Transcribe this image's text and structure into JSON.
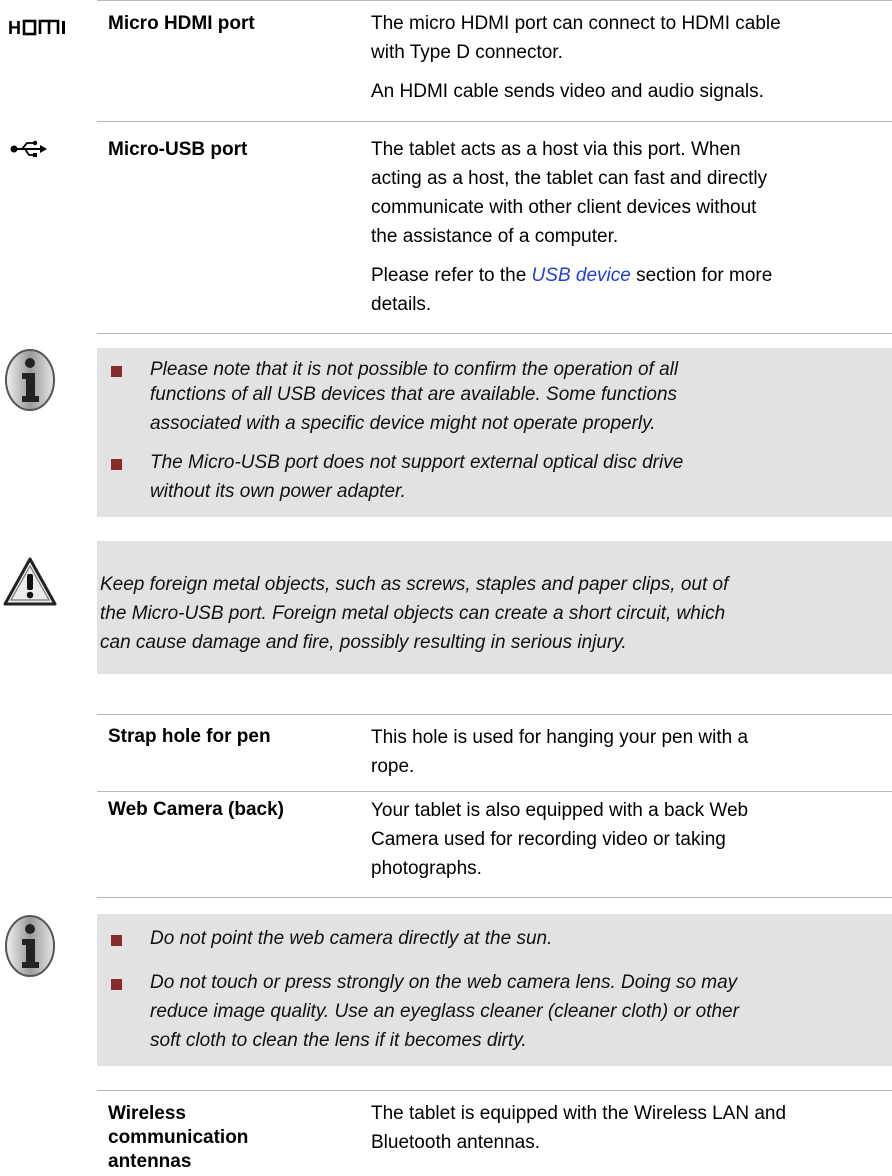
{
  "sections": {
    "hdmi": {
      "icon": "hdmi-logo-icon",
      "icon_text": "HDMI",
      "term": "Micro HDMI port",
      "desc_p1_line1": "The micro HDMI port can connect to HDMI cable",
      "desc_p1_line2": "with Type D connector.",
      "desc_p2": "An HDMI cable sends video and audio signals."
    },
    "usb": {
      "icon": "usb-icon",
      "term": "Micro-USB port",
      "desc_line1": "The tablet acts as a host via this port. When",
      "desc_line2": "acting as a host, the tablet can fast and directly",
      "desc_line3": "communicate with other client devices without",
      "desc_line4": "the assistance of a computer.",
      "ref_before": "Please refer to the ",
      "ref_link": "USB device",
      "ref_after": " section for more",
      "ref_line2": "details."
    },
    "note1": {
      "icon": "info-icon",
      "b1_l1": "Please note that it is not possible to confirm the operation of all",
      "b1_l2": "functions of all USB devices that are available. Some functions",
      "b1_l3": "associated with a specific device might not operate properly.",
      "b2_l1": "The Micro-USB port does not support external optical disc drive",
      "b2_l2": "without its own power adapter."
    },
    "warning": {
      "icon": "warning-triangle-icon",
      "l1": "Keep foreign metal objects, such as screws, staples and paper clips, out of",
      "l2": "the Micro-USB port. Foreign metal objects can create a short circuit, which",
      "l3": "can cause damage and fire, possibly resulting in serious injury."
    },
    "table": {
      "row1_term": "Strap hole for pen",
      "row1_l1": "This hole is used for hanging your pen with a",
      "row1_l2": "rope.",
      "row2_term": "Web Camera (back)",
      "row2_l1": "Your tablet is also equipped with a back Web",
      "row2_l2": "Camera used for recording video or taking",
      "row2_l3": "photographs."
    },
    "note2": {
      "icon": "info-icon",
      "b1": "Do not point the web camera directly at the sun.",
      "b2_l1": "Do not touch or press strongly on the web camera lens. Doing so may",
      "b2_l2": "reduce image quality. Use an eyeglass cleaner (cleaner cloth) or other",
      "b2_l3": "soft cloth to clean the lens if it becomes dirty."
    },
    "antennas": {
      "term_l1": "Wireless",
      "term_l2": "communication",
      "term_l3": "antennas",
      "desc_l1": "The tablet is equipped with the Wireless LAN and",
      "desc_l2": "Bluetooth antennas."
    }
  },
  "colors": {
    "note_bg": "#e2e2e2",
    "bullet": "#8b2a2a",
    "link": "#1f3fd6",
    "rule": "#b8b8b8"
  }
}
